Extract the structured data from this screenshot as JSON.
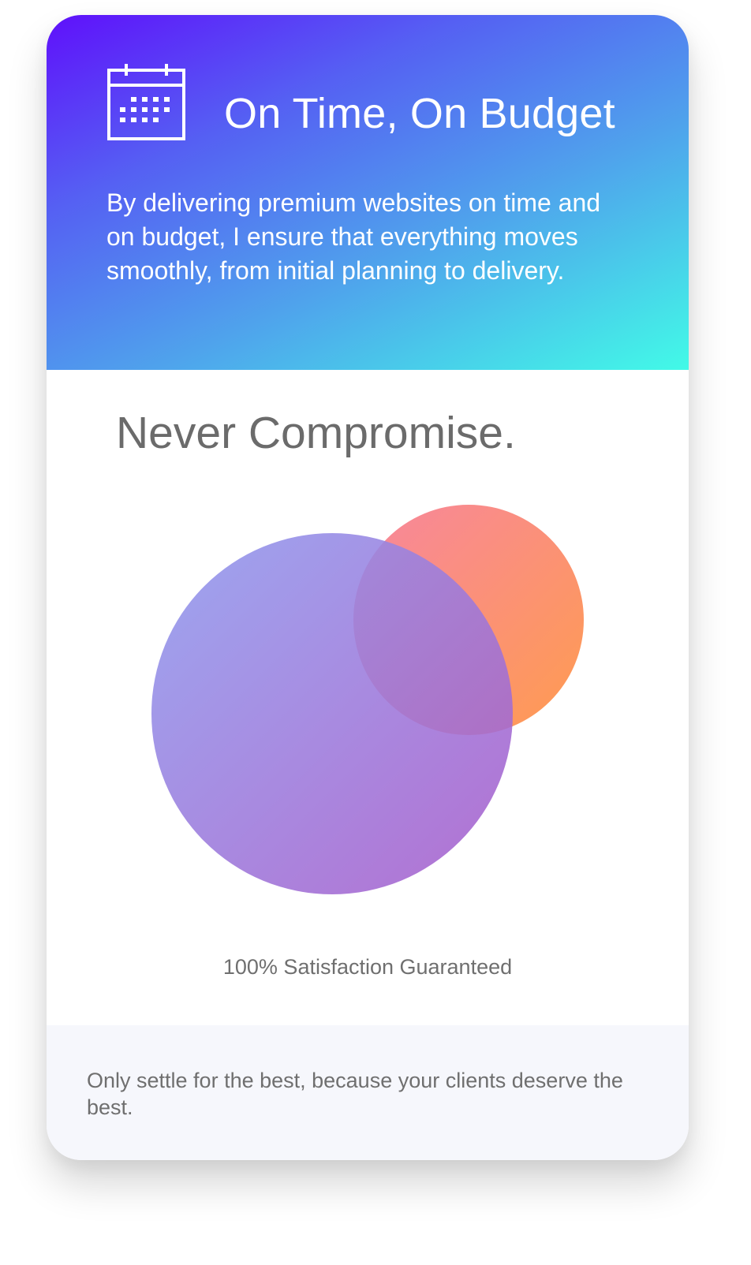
{
  "hero": {
    "icon": "calendar-icon",
    "title": "On Time, On Budget",
    "description": "By delivering premium websites on time and on budget, I ensure that everything moves smoothly, from initial planning to delivery.",
    "gradient": [
      "#5f10fb",
      "#42fae7"
    ]
  },
  "feature": {
    "headline": "Never Compromise.",
    "guarantee": "100% Satisfaction Guaranteed",
    "circle_colors": {
      "large": [
        "#8f94ec",
        "#a75ccb"
      ],
      "small": [
        "#f78a9c",
        "#ff9a52"
      ]
    }
  },
  "footer": {
    "text": "Only settle for the best, because your clients deserve the best."
  }
}
